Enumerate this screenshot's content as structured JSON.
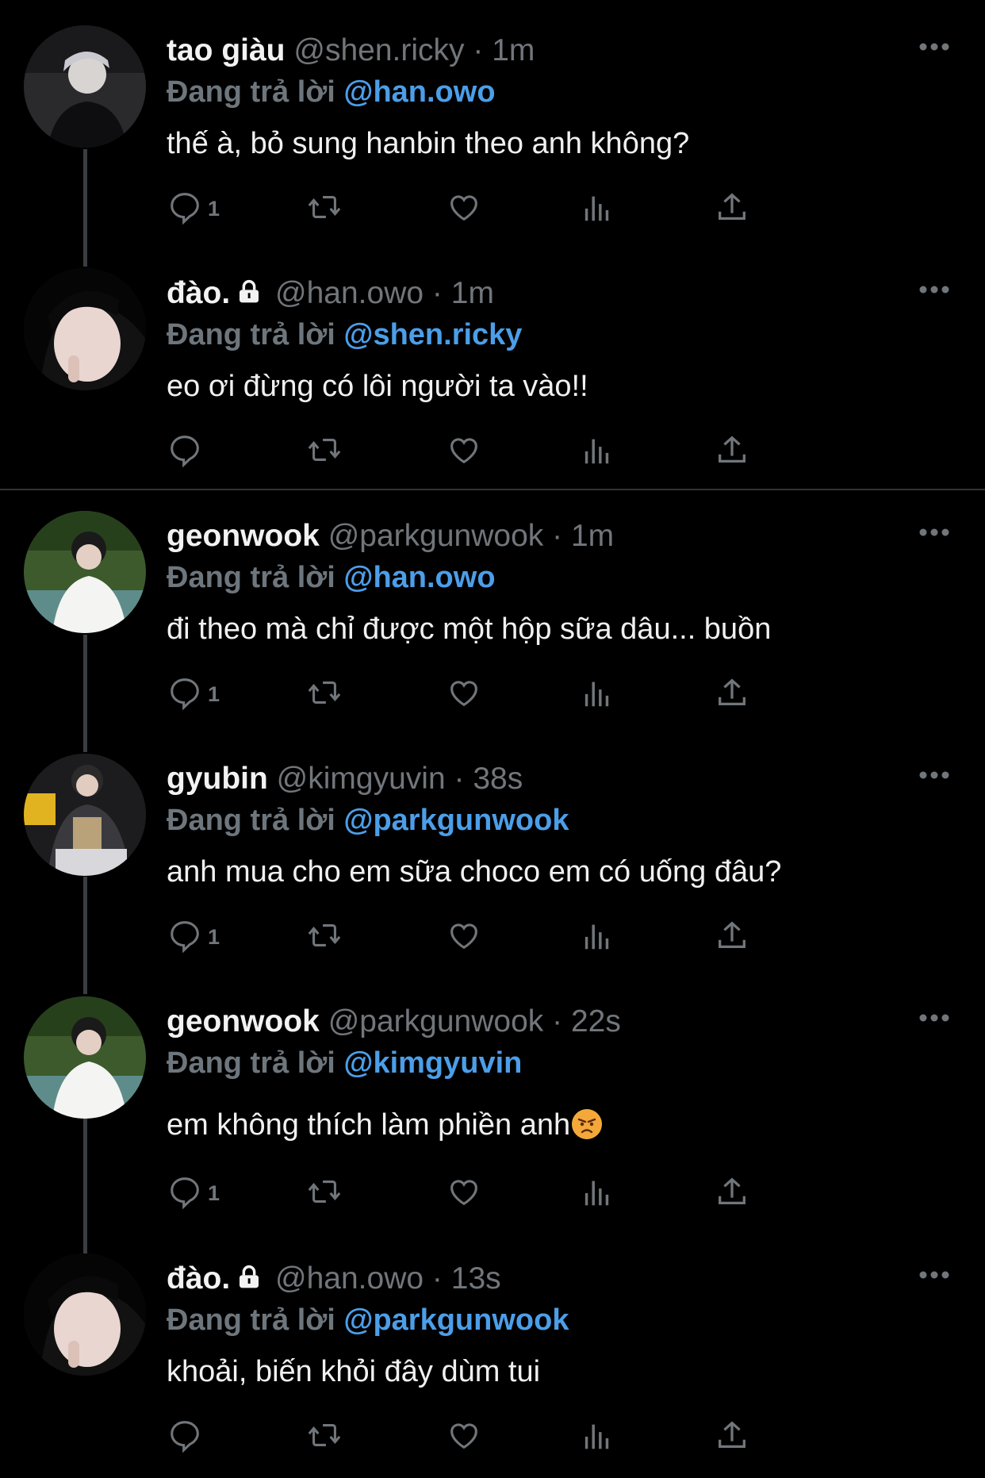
{
  "colors": {
    "background": "#000000",
    "mention": "#4c9ee8",
    "muted": "#71767b",
    "text": "#e7e9ea"
  },
  "reply_prefix": "Đang trả lời",
  "tweets": [
    {
      "name": "tao giàu",
      "locked": false,
      "handle": "@shen.ricky",
      "time": "1m",
      "reply_to": "@han.owo",
      "text": "thế à, bỏ sung hanbin theo anh không?",
      "reply_count": "1"
    },
    {
      "name": "đào.",
      "locked": true,
      "handle": "@han.owo",
      "time": "1m",
      "reply_to": "@shen.ricky",
      "text": "eo ơi đừng có lôi người ta vào!!",
      "reply_count": ""
    },
    {
      "name": "geonwook",
      "locked": false,
      "handle": "@parkgunwook",
      "time": "1m",
      "reply_to": "@han.owo",
      "text": "đi theo mà chỉ được một hộp sữa dâu... buồn",
      "reply_count": "1"
    },
    {
      "name": "gyubin",
      "locked": false,
      "handle": "@kimgyuvin",
      "time": "38s",
      "reply_to": "@parkgunwook",
      "text": "anh mua cho em sữa choco em có uống đâu?",
      "reply_count": "1"
    },
    {
      "name": "geonwook",
      "locked": false,
      "handle": "@parkgunwook",
      "time": "22s",
      "reply_to": "@kimgyuvin",
      "text": "em không thích làm phiền anh",
      "text_emoji": "angry-face-emoji",
      "reply_count": "1"
    },
    {
      "name": "đào.",
      "locked": true,
      "handle": "@han.owo",
      "time": "13s",
      "reply_to": "@parkgunwook",
      "text": "khoải, biến khỏi đây dùm tui",
      "reply_count": ""
    }
  ],
  "icons": {
    "reply": "reply-icon",
    "retweet": "retweet-icon",
    "like": "heart-icon",
    "views": "views-icon",
    "share": "share-icon",
    "more": "more-icon",
    "lock": "lock-icon"
  }
}
